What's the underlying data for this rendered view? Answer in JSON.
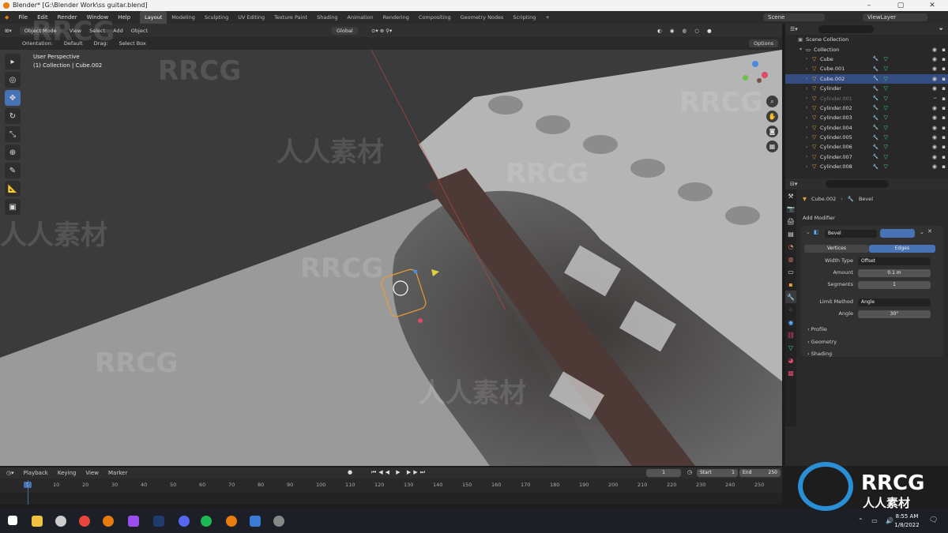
{
  "window": {
    "title": "Blender* [G:\\Blender Work\\ss guitar.blend]",
    "min": "–",
    "max": "▢",
    "close": "✕"
  },
  "menu": [
    "File",
    "Edit",
    "Render",
    "Window",
    "Help"
  ],
  "workspaces": [
    "Layout",
    "Modeling",
    "Sculpting",
    "UV Editing",
    "Texture Paint",
    "Shading",
    "Animation",
    "Rendering",
    "Compositing",
    "Geometry Nodes",
    "Scripting",
    "+"
  ],
  "scene": {
    "label": "Scene",
    "viewlayer": "ViewLayer"
  },
  "viewport_header": {
    "mode": "Object Mode",
    "view": "View",
    "select": "Select",
    "add": "Add",
    "object": "Object",
    "transform": "Global"
  },
  "tool_header": {
    "orientation_label": "Orientation:",
    "orientation_value": "Default",
    "drag_label": "Drag:",
    "drag_value": "Select Box",
    "options": "Options"
  },
  "viewport": {
    "perspective": "User Perspective",
    "context": "(1) Collection | Cube.002"
  },
  "outliner": {
    "root": "Scene Collection",
    "collection": "Collection",
    "items": [
      {
        "name": "Cube",
        "state": "normal"
      },
      {
        "name": "Cube.001",
        "state": "normal"
      },
      {
        "name": "Cube.002",
        "state": "selected"
      },
      {
        "name": "Cylinder",
        "state": "normal"
      },
      {
        "name": "Cylinder.001",
        "state": "hidden"
      },
      {
        "name": "Cylinder.002",
        "state": "normal"
      },
      {
        "name": "Cylinder.003",
        "state": "normal"
      },
      {
        "name": "Cylinder.004",
        "state": "normal"
      },
      {
        "name": "Cylinder.005",
        "state": "normal"
      },
      {
        "name": "Cylinder.006",
        "state": "normal"
      },
      {
        "name": "Cylinder.007",
        "state": "normal"
      },
      {
        "name": "Cylinder.008",
        "state": "normal"
      }
    ]
  },
  "properties": {
    "object": "Cube.002",
    "modifier_name": "Bevel",
    "add_modifier": "Add Modifier",
    "bevel_name": "Bevel",
    "affect_vertices": "Vertices",
    "affect_edges": "Edges",
    "width_type_label": "Width Type",
    "width_type_value": "Offset",
    "amount_label": "Amount",
    "amount_value": "0.1 m",
    "segments_label": "Segments",
    "segments_value": "1",
    "limit_label": "Limit Method",
    "limit_value": "Angle",
    "angle_label": "Angle",
    "angle_value": "30°",
    "sections": [
      "Profile",
      "Geometry",
      "Shading"
    ]
  },
  "timeline": {
    "menus": [
      "Playback",
      "Keying",
      "View",
      "Marker"
    ],
    "current_frame": "1",
    "start_label": "Start",
    "start_value": "1",
    "end_label": "End",
    "end_value": "250",
    "ticks": [
      "1",
      "10",
      "20",
      "30",
      "40",
      "50",
      "60",
      "70",
      "80",
      "90",
      "100",
      "110",
      "120",
      "130",
      "140",
      "150",
      "160",
      "170",
      "180",
      "190",
      "200",
      "210",
      "220",
      "230",
      "240",
      "250"
    ]
  },
  "taskbar": {
    "time": "8:55 AM",
    "date": "1/8/2022"
  },
  "watermark": {
    "brand": "RRCG",
    "cn": "人人素材"
  },
  "colors": {
    "accent": "#4772b3",
    "selection": "#334d80",
    "object_orange": "#e89b35",
    "modifier_blue": "#5cb0ff",
    "mesh_green": "#3fd68c"
  }
}
